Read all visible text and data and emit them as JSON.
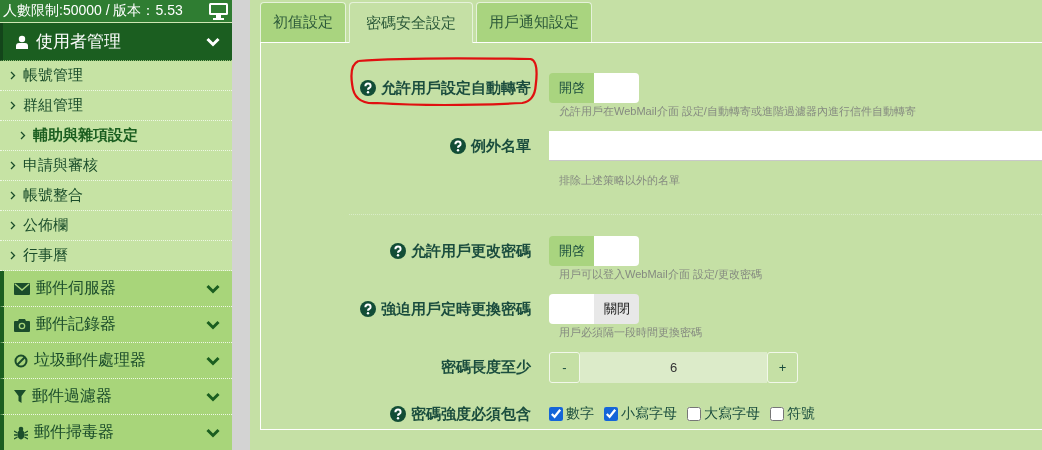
{
  "status_bar": {
    "text": "人數限制:50000 / 版本：5.53"
  },
  "sidebar": {
    "header": {
      "label": "使用者管理",
      "expanded": true
    },
    "items": [
      {
        "label": "帳號管理",
        "selected": false
      },
      {
        "label": "群組管理",
        "selected": false
      },
      {
        "label": "輔助與雜項設定",
        "selected": true
      },
      {
        "label": "申請與審核",
        "selected": false
      },
      {
        "label": "帳號整合",
        "selected": false
      },
      {
        "label": "公佈欄",
        "selected": false
      },
      {
        "label": "行事曆",
        "selected": false
      }
    ],
    "sections": [
      {
        "label": "郵件伺服器",
        "expanded": false
      },
      {
        "label": "郵件記錄器",
        "expanded": false
      },
      {
        "label": "垃圾郵件處理器",
        "expanded": false
      },
      {
        "label": "郵件過濾器",
        "expanded": false
      },
      {
        "label": "郵件掃毒器",
        "expanded": false
      }
    ]
  },
  "tabs": [
    {
      "label": "初值設定",
      "selected": false
    },
    {
      "label": "密碼安全設定",
      "selected": true
    },
    {
      "label": "用戶通知設定",
      "selected": false
    }
  ],
  "groups": [
    [
      {
        "kind": "toggle",
        "label": "允許用戶設定自動轉寄",
        "help": true,
        "circled": true,
        "on": true,
        "switch_label": "開啓",
        "hint": "允許用戶在WebMail介面 設定/自動轉寄或進階過濾器內進行信件自動轉寄"
      },
      {
        "kind": "text",
        "label": "例外名單",
        "help": true,
        "circled": false,
        "hint": "排除上述策略以外的名單"
      }
    ],
    [
      {
        "kind": "toggle",
        "label": "允許用戶更改密碼",
        "help": true,
        "circled": false,
        "on": true,
        "switch_label": "開啓",
        "hint": "用戶可以登入WebMail介面 設定/更改密碼"
      },
      {
        "kind": "toggle",
        "label": "強迫用戶定時更換密碼",
        "help": true,
        "circled": false,
        "on": false,
        "switch_label": "關閉",
        "hint": "用戶必須隔一段時間更換密碼"
      },
      {
        "kind": "stepper",
        "label": "密碼長度至少",
        "help": false,
        "circled": false,
        "minus": "-",
        "value": "6",
        "plus": "+"
      },
      {
        "kind": "checks",
        "label": "密碼強度必須包含",
        "help": true,
        "circled": false,
        "options": [
          {
            "label": "數字",
            "checked": true
          },
          {
            "label": "小寫字母",
            "checked": true
          },
          {
            "label": "大寫字母",
            "checked": false
          },
          {
            "label": "符號",
            "checked": false
          }
        ]
      }
    ]
  ]
}
